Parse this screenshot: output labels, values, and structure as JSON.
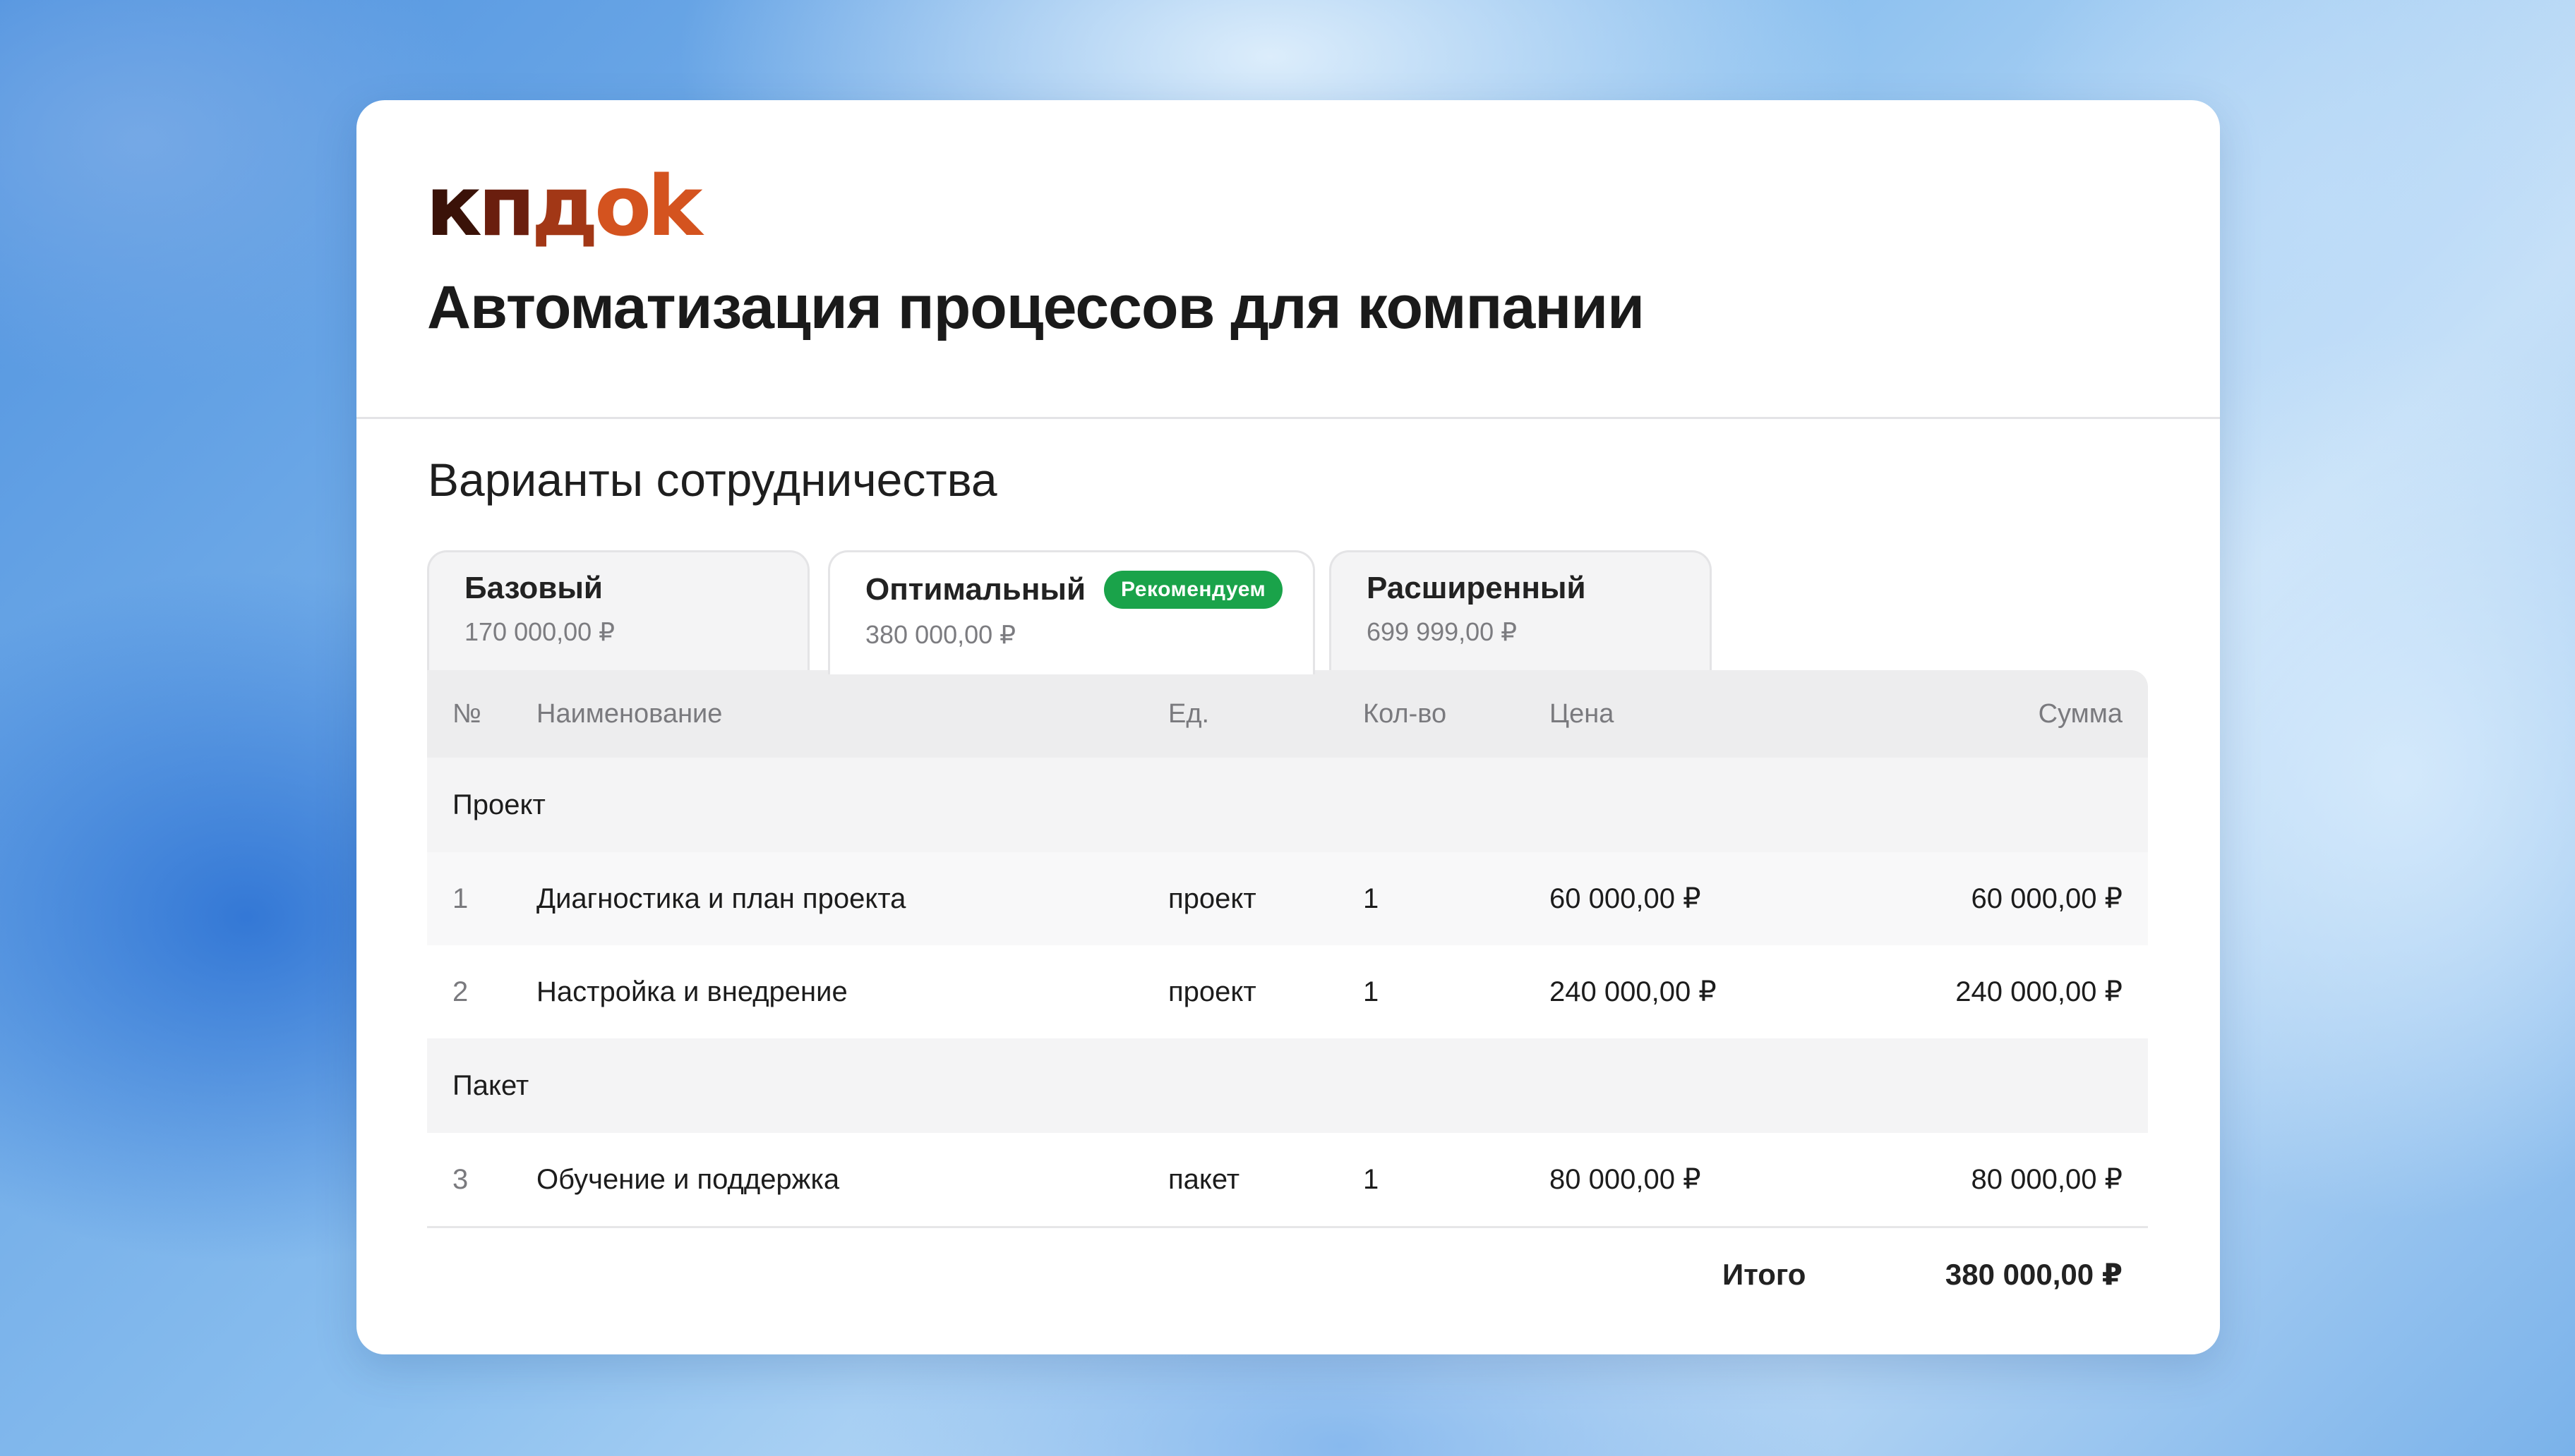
{
  "brand": {
    "logo_text": "кпдоk"
  },
  "page_title": "Автоматизация процессов для компании",
  "section_title": "Варианты сотрудничества",
  "tabs": [
    {
      "name": "Базовый",
      "price": "170 000,00 ₽",
      "active": false
    },
    {
      "name": "Оптимальный",
      "price": "380 000,00 ₽",
      "active": true,
      "badge": "Рекомендуем"
    },
    {
      "name": "Расширенный",
      "price": "699 999,00 ₽",
      "active": false
    }
  ],
  "table": {
    "headers": {
      "no": "№",
      "name": "Наименование",
      "unit": "Ед.",
      "qty": "Кол-во",
      "price": "Цена",
      "sum": "Сумма"
    },
    "groups": [
      {
        "title": "Проект",
        "items": [
          {
            "no": "1",
            "name": "Диагностика и план проекта",
            "unit": "проект",
            "qty": "1",
            "price": "60 000,00 ₽",
            "sum": "60 000,00 ₽"
          },
          {
            "no": "2",
            "name": "Настройка и внедрение",
            "unit": "проект",
            "qty": "1",
            "price": "240 000,00 ₽",
            "sum": "240 000,00 ₽"
          }
        ]
      },
      {
        "title": "Пакет",
        "items": [
          {
            "no": "3",
            "name": "Обучение и поддержка",
            "unit": "пакет",
            "qty": "1",
            "price": "80 000,00 ₽",
            "sum": "80 000,00 ₽"
          }
        ]
      }
    ],
    "total": {
      "label": "Итого",
      "value": "380 000,00 ₽"
    }
  },
  "colors": {
    "badge_green": "#1aa34a",
    "logo_dark": "#3a1208",
    "logo_orange": "#d4531f"
  }
}
